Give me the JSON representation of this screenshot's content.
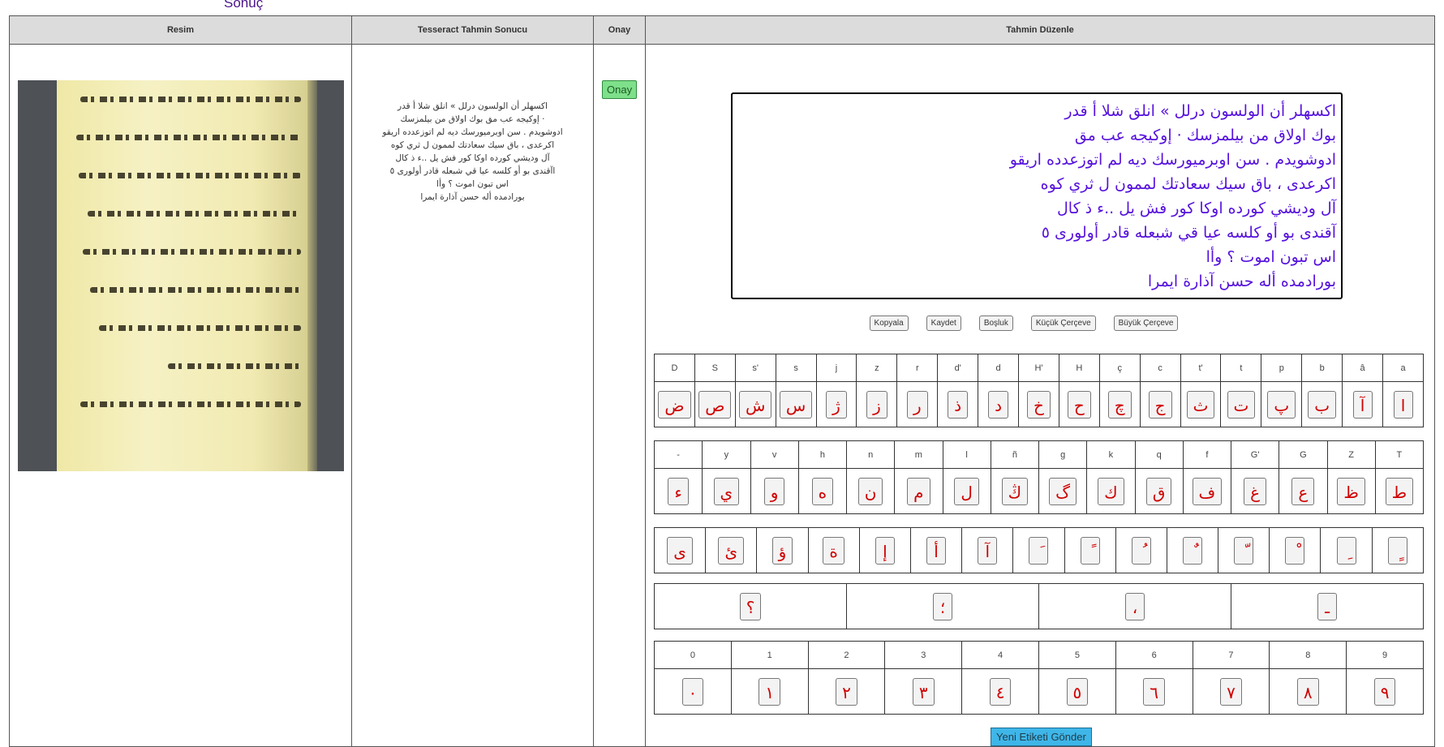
{
  "page_heading": "Sonuç",
  "headers": {
    "image": "Resim",
    "ocr": "Tesseract Tahmin Sonucu",
    "approve": "Onay",
    "edit": "Tahmin Düzenle"
  },
  "ocr_lines": [
    "اكسهلر أن الولسون درلل » انلق شلا أ قدر",
    "· إوكيجه عب مق بوك اولاق من بيلمزسك",
    "ادوشويدم . سن اوبرميورسك ديه لم اتوزعدده اريقو",
    "اكرعدى ، باق سيك سعادتك لممون ل ثري كوه",
    "آل وديشي كورده اوكا كور فش يل ..ء ذ كال",
    "اآقندى بو أو كلسه عيا قي شبعله قادر أولورى ٥",
    "اس تبون اموت ؟ وأا",
    "بورادمده أله حسن آذارة ايمرا"
  ],
  "approve_button": "Onay",
  "editor_text": "اكسهلر أن الولسون درلل » انلق شلا أ قدر\nبوك اولاق من بيلمزسك · إوكيجه عب مق\nادوشويدم . سن اوبرميورسك ديه لم اتوزعدده اريقو\nاكرعدى ، باق سيك سعادتك لممون ل ثري كوه\nآل وديشي كورده اوكا كور فش يل ..ء ذ كال\nآقندى بو أو كلسه عيا قي شبعله قادر أولورى ٥\nاس تبون اموت ؟ وأا\nبورادمده أله حسن آذارة ايمرا",
  "tools": {
    "copy": "Kopyala",
    "save": "Kaydet",
    "space": "Boşluk",
    "small_frame": "Küçük Çerçeve",
    "large_frame": "Büyük Çerçeve"
  },
  "keyboard": {
    "row1_labels": [
      "D",
      "S",
      "s'",
      "s",
      "j",
      "z",
      "r",
      "d'",
      "d",
      "H'",
      "H",
      "ç",
      "c",
      "t'",
      "t",
      "p",
      "b",
      "â",
      "a"
    ],
    "row1_keys": [
      "ض",
      "ص",
      "ش",
      "س",
      "ژ",
      "ز",
      "ر",
      "ذ",
      "د",
      "خ",
      "ح",
      "چ",
      "ج",
      "ث",
      "ت",
      "پ",
      "ب",
      "آ",
      "ا"
    ],
    "row2_labels": [
      "-",
      "y",
      "v",
      "h",
      "n",
      "m",
      "l",
      "ñ",
      "g",
      "k",
      "q",
      "f",
      "G'",
      "G",
      "Z",
      "T"
    ],
    "row2_keys": [
      "ء",
      "ي",
      "و",
      "ه",
      "ن",
      "م",
      "ل",
      "ڭ",
      "گ",
      "ك",
      "ق",
      "ف",
      "غ",
      "ع",
      "ظ",
      "ط"
    ],
    "row3_keys": [
      "ى",
      "ئ",
      "ؤ",
      "ة",
      "إ",
      "أ",
      "آ",
      "َ",
      "ً",
      "ُ",
      "ٌ",
      "ّ",
      "ْ",
      "ِ",
      "ٍ"
    ],
    "row4_keys": [
      "؟",
      "؛",
      "،",
      "ـ"
    ],
    "row5_labels": [
      "0",
      "1",
      "2",
      "3",
      "4",
      "5",
      "6",
      "7",
      "8",
      "9"
    ],
    "row5_keys": [
      "٠",
      "١",
      "٢",
      "٣",
      "٤",
      "٥",
      "٦",
      "٧",
      "٨",
      "٩"
    ]
  },
  "submit_button": "Yeni Etiketi Gönder",
  "colors": {
    "heading": "#4b1489",
    "editor_text": "#5511dd",
    "key_text": "#d00000",
    "approve_bg": "#7ee08a",
    "submit_bg": "#3fb6e8"
  }
}
